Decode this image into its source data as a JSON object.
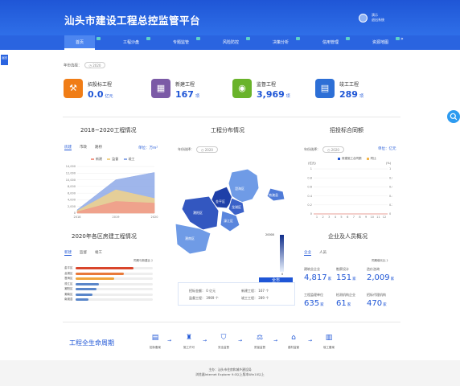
{
  "header": {
    "title": "汕头市建设工程总控监管平台",
    "user_name": "演示",
    "user_role": "退出系统"
  },
  "nav": {
    "items": [
      "首页",
      "工程沙盘",
      "专题监管",
      "风险防控",
      "决策分析",
      "信用管理",
      "资源地图"
    ],
    "more": "»"
  },
  "side_tab": "返回",
  "search_icon": "search-icon",
  "year_filter": {
    "label": "年份选择：",
    "value": "2020"
  },
  "stats": [
    {
      "label": "招投标工程",
      "value": "0.0",
      "unit": "亿元",
      "icon": "gavel-icon",
      "color": "#f07d16"
    },
    {
      "label": "新建工程",
      "value": "167",
      "unit": "项",
      "icon": "building-icon",
      "color": "#7b5aa6"
    },
    {
      "label": "监督工程",
      "value": "3,969",
      "unit": "项",
      "icon": "eye-icon",
      "color": "#69b32a"
    },
    {
      "label": "竣工工程",
      "value": "289",
      "unit": "项",
      "icon": "city-icon",
      "color": "#2d6fd6"
    }
  ],
  "projects_panel": {
    "title": "2018~2020工程情况",
    "tabs": [
      "房建",
      "市政",
      "路桥"
    ],
    "unit": "单位：万m²",
    "legend": [
      "新建",
      "监督",
      "竣工"
    ]
  },
  "chart_data": {
    "type": "area",
    "categories": [
      "2018",
      "2019",
      "2020"
    ],
    "ylim": [
      0,
      14000
    ],
    "yticks": [
      "14,000",
      "12,000",
      "10,000",
      "8,000",
      "6,000",
      "4,000",
      "2,000",
      "0"
    ],
    "series": [
      {
        "name": "竣工",
        "values": [
          1000,
          10000,
          12200
        ],
        "color": "#8ea9e8"
      },
      {
        "name": "监督",
        "values": [
          700,
          7000,
          4400
        ],
        "color": "#f1d28a"
      },
      {
        "name": "新建",
        "values": [
          400,
          3500,
          3000
        ],
        "color": "#f19a8a"
      }
    ]
  },
  "distribution_panel": {
    "title": "工程分布情况",
    "year_label": "年份选择：",
    "year_value": "2020",
    "districts": [
      "龙湖区",
      "金平区",
      "濠江区",
      "澄海区",
      "潮阳区",
      "潮南区",
      "南澳县"
    ],
    "scale_max": "20000",
    "scale_min": "0",
    "city_label": "全市",
    "info": {
      "bid_amount_label": "招标金额：",
      "bid_amount_value": "0 亿元",
      "new_label": "新建工程：",
      "new_value": "167 个",
      "supervise_label": "监督工程：",
      "supervise_value": "3969 个",
      "complete_label": "竣工工程：",
      "complete_value": "289 个"
    }
  },
  "bidding_panel": {
    "title": "招投标合同额",
    "year_label": "年份选择：",
    "year_value": "2020",
    "unit": "单位：亿元",
    "left_axis": "(亿元)",
    "right_axis": "(%)",
    "legend": [
      "房建施工合同额",
      "同比"
    ],
    "yticks": [
      "1",
      "0.8",
      "0.6",
      "0.4",
      "0.2",
      "0"
    ],
    "xticks": [
      "1",
      "2",
      "3",
      "4",
      "5",
      "6",
      "7",
      "8",
      "9",
      "10",
      "11",
      "12"
    ]
  },
  "housing_panel": {
    "title": "2020年各区房建工程情况",
    "tabs": [
      "新建",
      "监督",
      "竣工"
    ],
    "note": "同期与新建比 》",
    "rows": [
      {
        "label": "金平区",
        "value": 0.75,
        "color": "#d9452b"
      },
      {
        "label": "龙湖区",
        "value": 0.62,
        "color": "#e87a3a"
      },
      {
        "label": "澄海区",
        "value": 0.5,
        "color": "#f1a43a"
      },
      {
        "label": "濠江区",
        "value": 0.3,
        "color": "#5a86c9"
      },
      {
        "label": "潮阳区",
        "value": 0.27,
        "color": "#5a86c9"
      },
      {
        "label": "潮南区",
        "value": 0.22,
        "color": "#5a86c9"
      },
      {
        "label": "南澳县",
        "value": 0.17,
        "color": "#5a86c9"
      }
    ]
  },
  "personnel_panel": {
    "title": "企业及人员概况",
    "tabs": [
      "企业",
      "人员"
    ],
    "note": "同期增长比 》",
    "items": [
      {
        "label": "建筑业企业",
        "value": "4,817",
        "unit": "家"
      },
      {
        "label": "勘察设计",
        "value": "151",
        "unit": "家"
      },
      {
        "label": "造价咨询",
        "value": "2,009",
        "unit": "家"
      },
      {
        "label": "工程监理单位",
        "value": "635",
        "unit": "家"
      },
      {
        "label": "检测机构企业",
        "value": "61",
        "unit": "家"
      },
      {
        "label": "招标代理机构",
        "value": "470",
        "unit": "家"
      }
    ]
  },
  "lifecycle": {
    "title": "工程全生命周期",
    "steps": [
      {
        "label": "招标备案",
        "icon": "document-icon"
      },
      {
        "label": "施工许可",
        "icon": "stamp-icon"
      },
      {
        "label": "安全监督",
        "icon": "shield-icon"
      },
      {
        "label": "质量监督",
        "icon": "scale-icon"
      },
      {
        "label": "建材监管",
        "icon": "bank-icon"
      },
      {
        "label": "竣工备案",
        "icon": "file-icon"
      }
    ]
  },
  "footer": {
    "line1": "主办：汕头市住房和城乡建设局",
    "line2": "浏览器Internet Explorer 9.0以上版本Win10以上"
  }
}
